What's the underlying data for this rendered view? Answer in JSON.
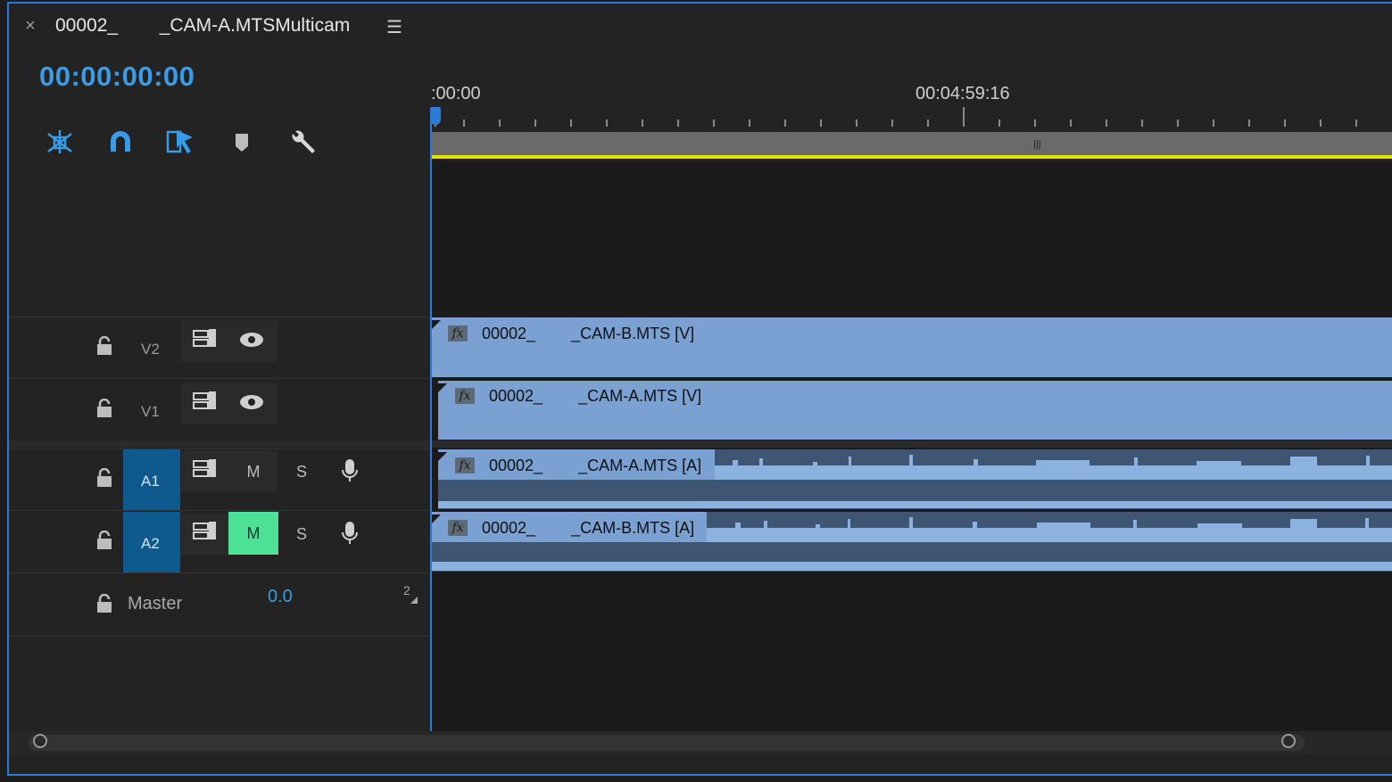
{
  "tab": {
    "close": "×",
    "title": "00002_        _CAM-A.MTSMulticam",
    "menu": "☰"
  },
  "timecode": "00:00:00:00",
  "toolbar": {
    "icons": [
      "nest-sequence-icon",
      "snap-magnet-icon",
      "linked-selection-icon",
      "add-marker-icon",
      "settings-wrench-icon"
    ]
  },
  "ruler": {
    "start_label": ":00:00",
    "mid_label": "00:04:59:16"
  },
  "tracks": {
    "v2": {
      "name": "V2"
    },
    "v1": {
      "name": "V1"
    },
    "a1": {
      "name": "A1",
      "m": "M",
      "s": "S"
    },
    "a2": {
      "name": "A2",
      "m": "M",
      "s": "S"
    },
    "master": {
      "name": "Master",
      "value": "0.0",
      "marker": "2"
    }
  },
  "clips": {
    "v2": {
      "fx": "fx",
      "name": "00002_        _CAM-B.MTS [V]"
    },
    "v1": {
      "fx": "fx",
      "name": "00002_        _CAM-A.MTS [V]"
    },
    "a1": {
      "fx": "fx",
      "name": "00002_        _CAM-A.MTS [A]"
    },
    "a2": {
      "fx": "fx",
      "name": "00002_        _CAM-B.MTS [A]"
    }
  },
  "colors": {
    "accent": "#2d7bd6",
    "timecode": "#3a9be6",
    "clip": "#7aa1d2",
    "mute_active": "#4ee296",
    "track_target": "#0e5a8e",
    "work_area": "#e6e000"
  }
}
